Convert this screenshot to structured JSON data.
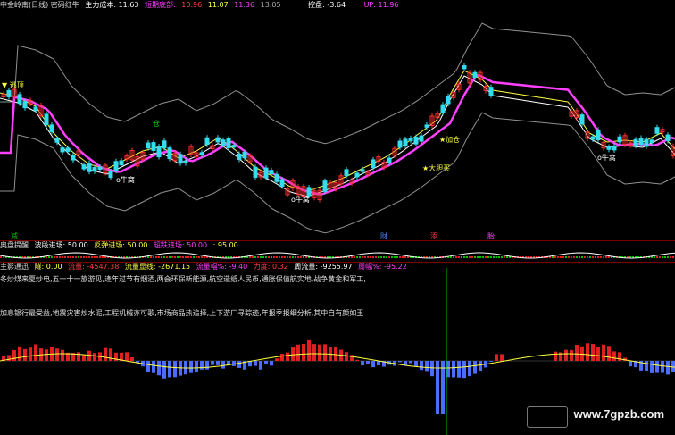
{
  "top_info": {
    "title": "中金岭南(日线) 密码红牛",
    "cost_label": "主力成本: 11.63",
    "short_label": "短期底部:",
    "v1": "10.96",
    "v2": "11.07",
    "v3": "11.36",
    "v4": "13.05",
    "control_label": "控盘: -3.64",
    "up_label": "UP: 11.96",
    "up_val": "11.96"
  },
  "chart_labels": {
    "top_left": "▼ 逃顶",
    "niu1": "o牛窝",
    "niu2": "o牛窝",
    "niu3": "o牛窝",
    "jiacang": "★加仓",
    "dadan": "★大胆买",
    "niu4": "o牛窝",
    "cang": "仓"
  },
  "marks": {
    "m1": "减",
    "m2": "财",
    "m3": "添",
    "m4": "胎"
  },
  "ind1": {
    "name": "奥盘提醒",
    "a": "波段进场: 50.00",
    "b": "反弹进场: 50.00",
    "c": "超跌进场: 50.00",
    "d": ": 95.00"
  },
  "ind2": {
    "name": "主影通迅",
    "a": "隧: 0.00",
    "b": "流量: -4547.38",
    "c": "流量显线: -2671.15",
    "d": "流量幅%: -9.40",
    "e": "力度: 0.32",
    "f": "周流量: -9255.97",
    "g": "周幅%: -95.22"
  },
  "notes": {
    "n1": "冬炒煤来夏炒电,五一十一旅游见,逢年过节有烟酒,两会环保新能源,航空造纸人民币,通胀保值航实地,战争黄金和军工,",
    "n2": "加息银行最受益,地震灾害炒水泥,工程机械亦可歌,市场商品热追择,上下游厂寻踪迹,年报季报细分析,其中自有颜如玉"
  },
  "watermark": "www.7gpzb.com",
  "colors": {
    "up": "#ff3030",
    "down": "#33ddee",
    "ma_white": "#ffffff",
    "ma_yellow": "#ffff40",
    "ma_magenta": "#ff40ff",
    "band_gray": "#909090",
    "vol_red": "#e02020",
    "vol_blue": "#4a6cff",
    "green": "#00c000"
  }
}
